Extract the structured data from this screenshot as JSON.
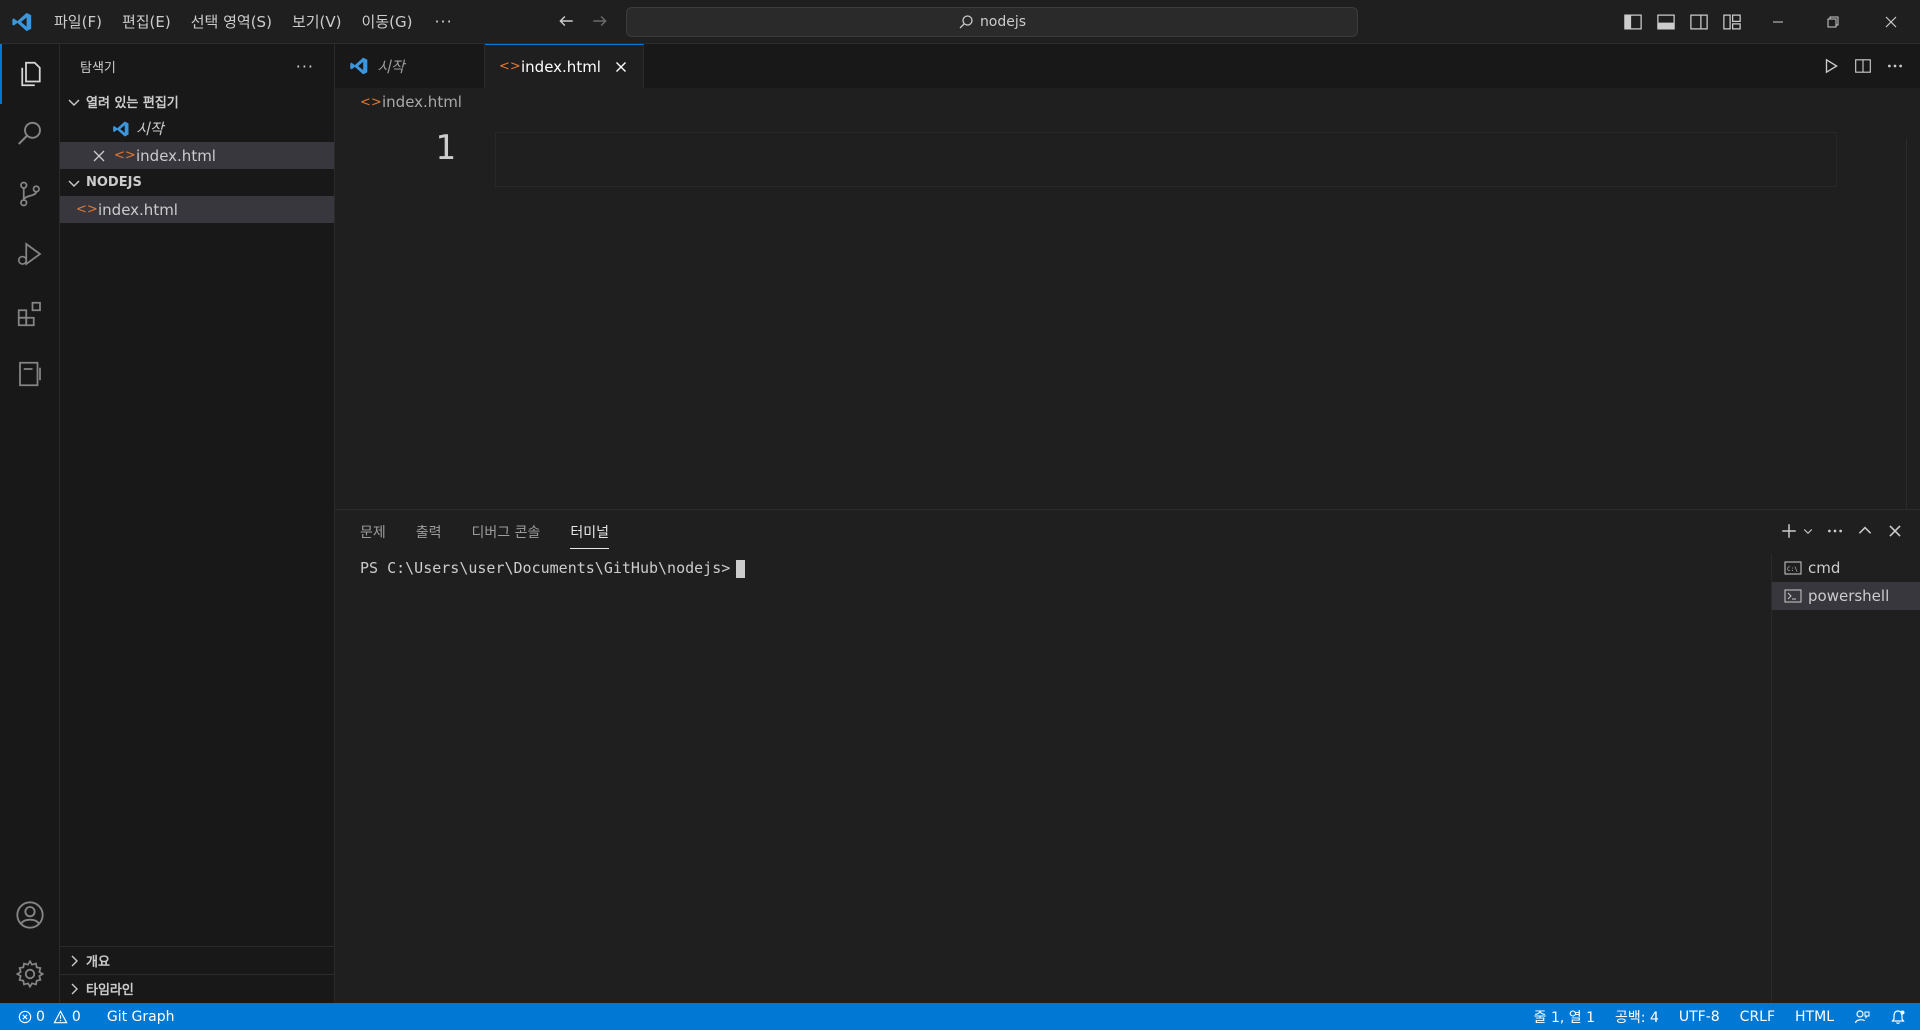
{
  "menu": {
    "items": [
      "파일(F)",
      "편집(E)",
      "선택 영역(S)",
      "보기(V)",
      "이동(G)"
    ],
    "more": "···"
  },
  "search": {
    "text": "nodejs"
  },
  "sidebar": {
    "title": "탐색기",
    "more": "···",
    "open_editors_label": "열려 있는 편집기",
    "open_editors": [
      {
        "label": "시작"
      },
      {
        "label": "index.html"
      }
    ],
    "folder_label": "NODEJS",
    "folder_files": [
      {
        "label": "index.html"
      }
    ],
    "outline_label": "개요",
    "timeline_label": "타임라인"
  },
  "editor": {
    "tabs": [
      {
        "label": "시작"
      },
      {
        "label": "index.html"
      }
    ],
    "breadcrumb": "index.html",
    "line_number": "1"
  },
  "panel": {
    "tabs": [
      "문제",
      "출력",
      "디버그 콘솔",
      "터미널"
    ],
    "terminal_prompt": "PS C:\\Users\\user\\Documents\\GitHub\\nodejs>",
    "terminals": [
      "cmd",
      "powershell"
    ]
  },
  "statusbar": {
    "errors": "0",
    "warnings": "0",
    "git_graph": "Git Graph",
    "position": "줄 1, 열 1",
    "spaces": "공백: 4",
    "encoding": "UTF-8",
    "eol": "CRLF",
    "language": "HTML"
  },
  "colors": {
    "accent": "#0078d4",
    "html_icon": "#e37933",
    "vscode_logo": "#3a96dd"
  }
}
